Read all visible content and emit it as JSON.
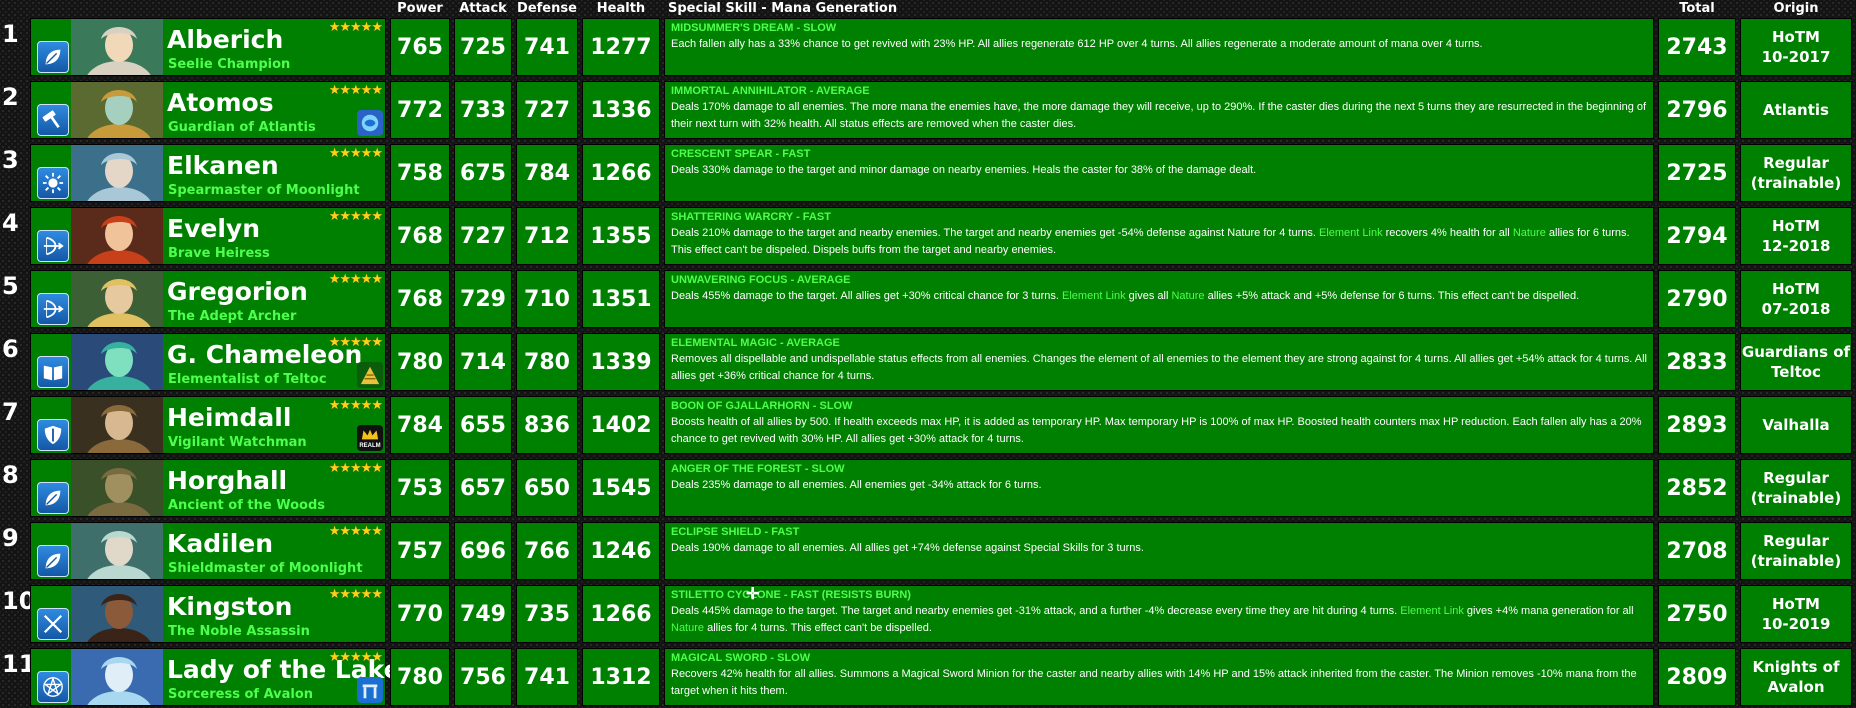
{
  "headers": {
    "power": "Power",
    "attack": "Attack",
    "defense": "Defense",
    "health": "Health",
    "skill": "Special Skill - Mana Generation",
    "total": "Total",
    "origin": "Origin"
  },
  "colors": {
    "row_bg": "#008000",
    "title_green": "#4cff4c",
    "star_gold": "#ffd21a",
    "class_icon_blue": "#1e6fc4"
  },
  "heroes": [
    {
      "rank": "1",
      "name": "Alberich",
      "title": "Seelie Champion",
      "stars": "★★★★★",
      "class_icon": "leaf-icon",
      "badge": "",
      "power": "765",
      "attack": "725",
      "defense": "741",
      "health": "1277",
      "skill": "MIDSUMMER'S DREAM - SLOW",
      "desc": [
        {
          "t": "Each fallen ally has a 33% chance to get revived with 23% HP. All allies regenerate 612 HP over 4 turns. All allies regenerate a moderate amount of mana over 4 turns."
        }
      ],
      "total": "2743",
      "origin": "HoTM\n10-2017"
    },
    {
      "rank": "2",
      "name": "Atomos",
      "title": "Guardian of Atlantis",
      "stars": "★★★★★",
      "class_icon": "hammer-icon",
      "badge": "atlantis-badge-icon",
      "power": "772",
      "attack": "733",
      "defense": "727",
      "health": "1336",
      "skill": "IMMORTAL ANNIHILATOR - AVERAGE",
      "desc": [
        {
          "t": "Deals 170% damage to all enemies. The more mana the enemies have, the more damage they will receive, up to 290%. If the caster dies during the next 5 turns they are resurrected in the beginning of their next turn with 32% health. All status effects are removed when the caster dies."
        }
      ],
      "total": "2796",
      "origin": "Atlantis"
    },
    {
      "rank": "3",
      "name": "Elkanen",
      "title": "Spearmaster of Moonlight",
      "stars": "★★★★★",
      "class_icon": "sun-icon",
      "badge": "",
      "power": "758",
      "attack": "675",
      "defense": "784",
      "health": "1266",
      "skill": "CRESCENT SPEAR - FAST",
      "desc": [
        {
          "t": "Deals 330% damage to the target and minor damage on nearby enemies. Heals the caster for 38% of the damage dealt."
        }
      ],
      "total": "2725",
      "origin": "Regular\n(trainable)"
    },
    {
      "rank": "4",
      "name": "Evelyn",
      "title": "Brave Heiress",
      "stars": "★★★★★",
      "class_icon": "bow-icon",
      "badge": "",
      "power": "768",
      "attack": "727",
      "defense": "712",
      "health": "1355",
      "skill": "SHATTERING WARCRY - FAST",
      "desc": [
        {
          "t": "Deals 210% damage to the target and nearby enemies. The target and nearby enemies get -54% defense against Nature for 4 turns. "
        },
        {
          "t": "Element Link",
          "h": true
        },
        {
          "t": " recovers 4% health for all "
        },
        {
          "t": "Nature",
          "h": true
        },
        {
          "t": " allies for 6 turns. This effect can't be dispeled. Dispels buffs from the target and nearby enemies."
        }
      ],
      "total": "2794",
      "origin": "HoTM\n12-2018"
    },
    {
      "rank": "5",
      "name": "Gregorion",
      "title": "The Adept Archer",
      "stars": "★★★★★",
      "class_icon": "bow-icon",
      "badge": "",
      "power": "768",
      "attack": "729",
      "defense": "710",
      "health": "1351",
      "skill": "UNWAVERING FOCUS - AVERAGE",
      "desc": [
        {
          "t": "Deals 455% damage to the target. All allies get +30% critical chance for 3 turns. "
        },
        {
          "t": "Element Link",
          "h": true
        },
        {
          "t": " gives all "
        },
        {
          "t": "Nature",
          "h": true
        },
        {
          "t": " allies +5% attack and +5% defense for 6 turns. This effect can't be dispelled."
        }
      ],
      "total": "2790",
      "origin": "HoTM\n07-2018"
    },
    {
      "rank": "6",
      "name": "G. Chameleon",
      "title": "Elementalist of Teltoc",
      "stars": "★★★★★",
      "class_icon": "book-icon",
      "badge": "teltoc-pyramid-icon",
      "power": "780",
      "attack": "714",
      "defense": "780",
      "health": "1339",
      "skill": "ELEMENTAL MAGIC - AVERAGE",
      "desc": [
        {
          "t": "Removes all dispellable and undispellable status effects from all enemies. Changes the element of all enemies to the element they are strong against for 4 turns. All allies get +54% attack for 4 turns. All allies get +36% critical chance for 4 turns."
        }
      ],
      "total": "2833",
      "origin": "Guardians of\nTeltoc"
    },
    {
      "rank": "7",
      "name": "Heimdall",
      "title": "Vigilant Watchman",
      "stars": "★★★★★",
      "class_icon": "shield-icon",
      "badge": "realm-crown-icon",
      "badge_text": "REALM",
      "power": "784",
      "attack": "655",
      "defense": "836",
      "health": "1402",
      "skill": "BOON OF GJALLARHORN - SLOW",
      "desc": [
        {
          "t": "Boosts health of all allies by 500. If health exceeds max HP, it is added as temporary HP. Max temporary HP is 100% of max HP. Boosted health counters max HP reduction. Each fallen ally has a 20% chance to get revived with 30% HP. All allies get +30% attack for 4 turns."
        }
      ],
      "total": "2893",
      "origin": "Valhalla"
    },
    {
      "rank": "8",
      "name": "Horghall",
      "title": "Ancient of the Woods",
      "stars": "★★★★★",
      "class_icon": "leaf-icon",
      "badge": "",
      "power": "753",
      "attack": "657",
      "defense": "650",
      "health": "1545",
      "skill": "ANGER OF THE FOREST - SLOW",
      "desc": [
        {
          "t": "Deals 235% damage to all enemies. All enemies get -34% attack for 6 turns."
        }
      ],
      "total": "2852",
      "origin": "Regular\n(trainable)"
    },
    {
      "rank": "9",
      "name": "Kadilen",
      "title": "Shieldmaster of Moonlight",
      "stars": "★★★★★",
      "class_icon": "leaf-icon",
      "badge": "",
      "power": "757",
      "attack": "696",
      "defense": "766",
      "health": "1246",
      "skill": "ECLIPSE SHIELD - FAST",
      "desc": [
        {
          "t": "Deals 190% damage to all enemies. All allies get +74% defense against Special Skills for 3 turns."
        }
      ],
      "total": "2708",
      "origin": "Regular\n(trainable)"
    },
    {
      "rank": "10",
      "name": "Kingston",
      "title": "The Noble Assassin",
      "stars": "★★★★★",
      "class_icon": "crossed-daggers-icon",
      "badge": "",
      "power": "770",
      "attack": "749",
      "defense": "735",
      "health": "1266",
      "skill": "STILETTO CYCLONE - FAST (RESISTS BURN)",
      "desc": [
        {
          "t": "Deals 445% damage to the target. The target and nearby enemies get -31% attack, and a further -4% decrease every time they are hit during 4 turns. "
        },
        {
          "t": "Element Link",
          "h": true
        },
        {
          "t": " gives +4% mana generation for all "
        },
        {
          "t": "Nature",
          "h": true
        },
        {
          "t": " allies for 4 turns. This effect can't be dispelled."
        }
      ],
      "total": "2750",
      "origin": "HoTM\n10-2019"
    },
    {
      "rank": "11",
      "name": "Lady of the Lake",
      "title": "Sorceress of Avalon",
      "stars": "★★★★★",
      "class_icon": "pentagram-icon",
      "badge": "avalon-stonehenge-icon",
      "power": "780",
      "attack": "756",
      "defense": "741",
      "health": "1312",
      "skill": "MAGICAL SWORD - SLOW",
      "desc": [
        {
          "t": "Recovers 42% health for all allies. Summons a Magical Sword Minion for the caster and nearby allies with 14% HP and 15% attack inherited from the caster. The Minion removes -10% mana from the target when it hits them."
        }
      ],
      "total": "2809",
      "origin": "Knights of\nAvalon"
    }
  ]
}
